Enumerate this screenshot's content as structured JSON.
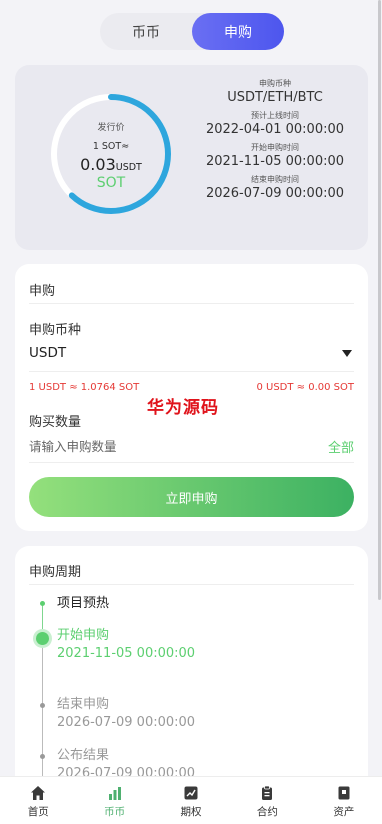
{
  "toggle": {
    "tabs": [
      "币币",
      "申购"
    ],
    "active_index": 1
  },
  "info": {
    "issue_price_label": "发行价",
    "rate_text": "1 SOT≈",
    "price_value": "0.03",
    "price_unit": "USDT",
    "coin_symbol": "SOT",
    "progress_fraction": 0.62,
    "items": [
      {
        "label": "申购币种",
        "value": "USDT/ETH/BTC"
      },
      {
        "label": "预计上线时间",
        "value": "2022-04-01 00:00:00"
      },
      {
        "label": "开始申购时间",
        "value": "2021-11-05 00:00:00"
      },
      {
        "label": "结束申购时间",
        "value": "2026-07-09 00:00:00"
      }
    ]
  },
  "subscribe": {
    "title": "申购",
    "coin_label": "申购币种",
    "coin_selected": "USDT",
    "rate_left": "1 USDT ≈ 1.0764 SOT",
    "rate_right": "0 USDT ≈ 0.00 SOT",
    "watermark": "华为源码",
    "qty_label": "购买数量",
    "qty_placeholder": "请输入申购数量",
    "all_label": "全部",
    "button_label": "立即申购"
  },
  "period": {
    "title": "申购周期",
    "steps": [
      {
        "name": "项目预热",
        "time": ""
      },
      {
        "name": "开始申购",
        "time": "2021-11-05 00:00:00"
      },
      {
        "name": "结束申购",
        "time": "2026-07-09 00:00:00"
      },
      {
        "name": "公布结果",
        "time": "2026-07-09 00:00:00"
      }
    ]
  },
  "nav": {
    "active_index": 1,
    "items": [
      {
        "label": "首页",
        "icon": "home-icon"
      },
      {
        "label": "币币",
        "icon": "bar-chart-icon"
      },
      {
        "label": "期权",
        "icon": "chart-line-icon"
      },
      {
        "label": "合约",
        "icon": "clipboard-icon"
      },
      {
        "label": "资产",
        "icon": "wallet-icon"
      }
    ]
  },
  "colors": {
    "accent_blue": "#4d56ee",
    "green": "#5ccf70",
    "red": "#e53935",
    "ring_blue": "#2ea6dd"
  }
}
